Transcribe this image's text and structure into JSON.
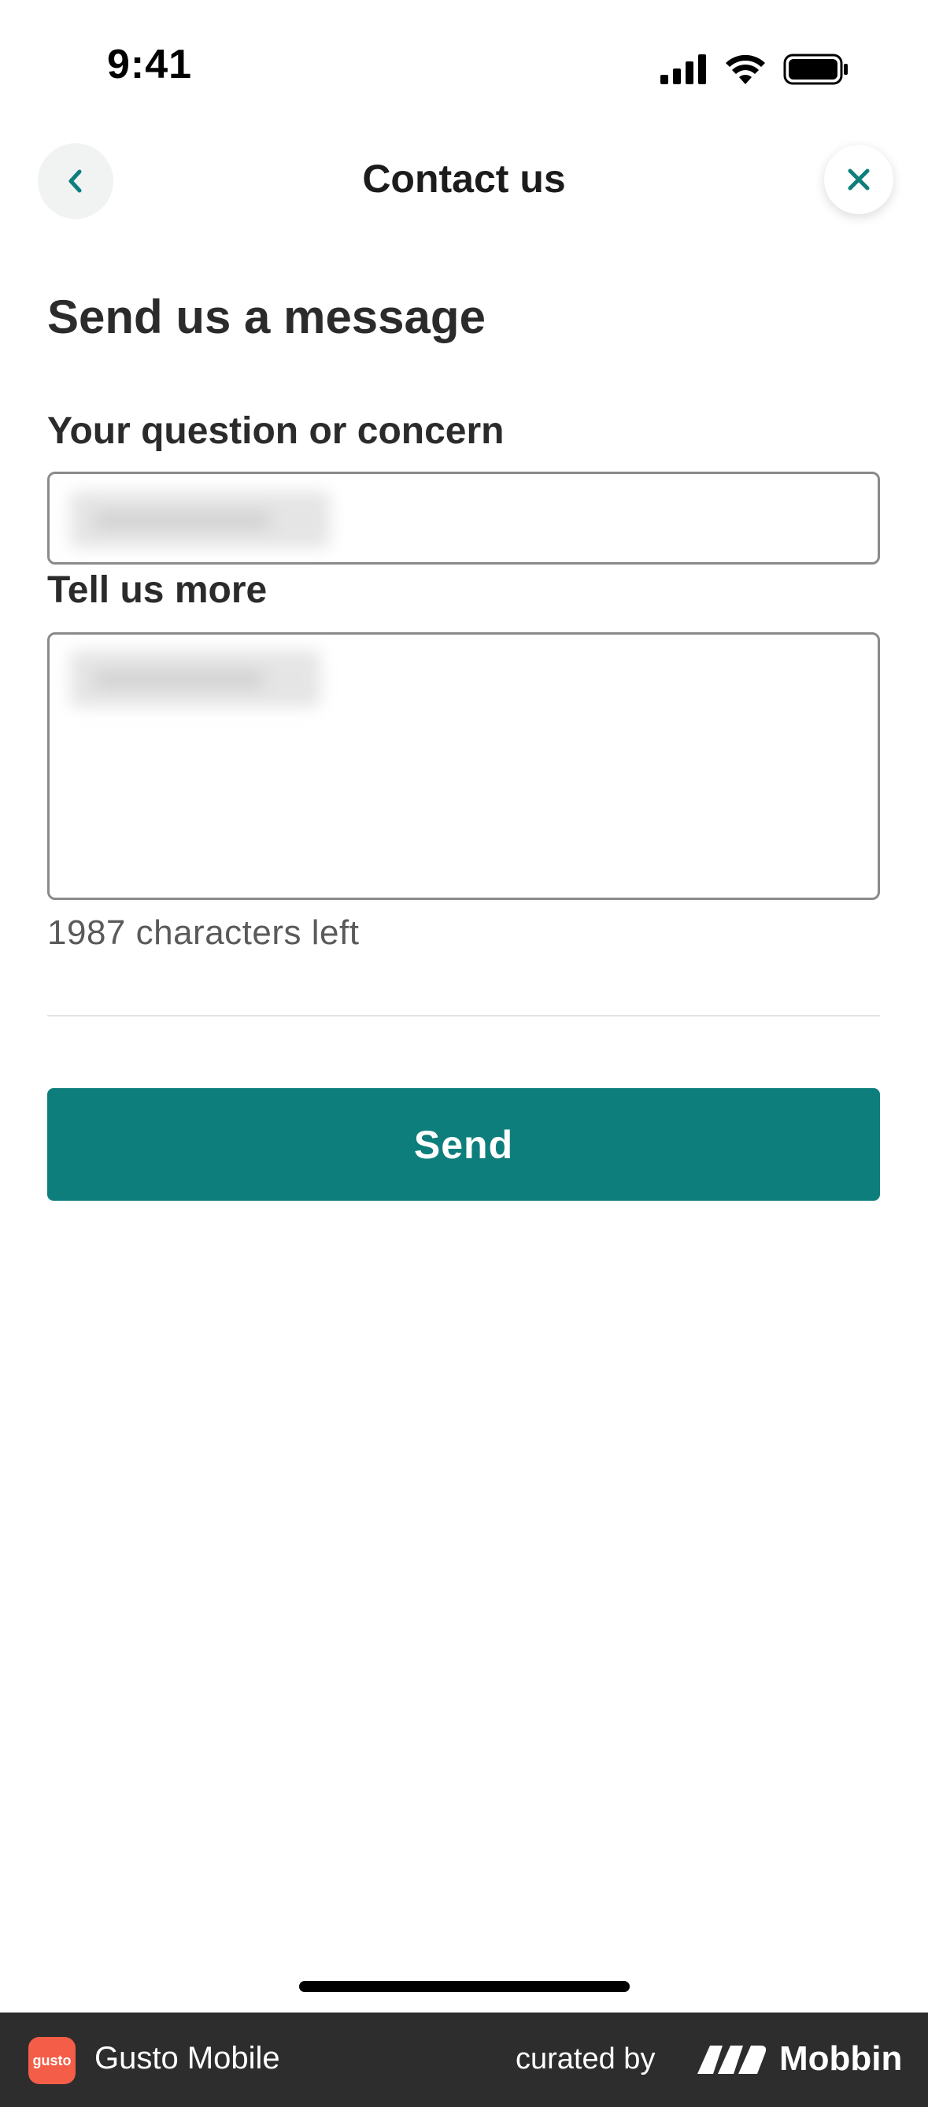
{
  "status_bar": {
    "time": "9:41",
    "icons": [
      "cellular-signal-icon",
      "wifi-icon",
      "battery-icon"
    ]
  },
  "header": {
    "title": "Contact us",
    "back_icon": "chevron-left-icon",
    "close_icon": "close-icon"
  },
  "form": {
    "heading": "Send us a message",
    "question_label": "Your question or concern",
    "question_value": "",
    "more_label": "Tell us more",
    "more_value": "",
    "characters_left": "1987 characters left",
    "send_label": "Send"
  },
  "footer": {
    "app_icon_text": "gusto",
    "app_name": "Gusto Mobile",
    "curated_by": "curated by",
    "brand": "Mobbin"
  },
  "colors": {
    "accent": "#0e7e7c",
    "footer_bg": "#2d2d2d",
    "app_icon_bg": "#f45d48"
  }
}
